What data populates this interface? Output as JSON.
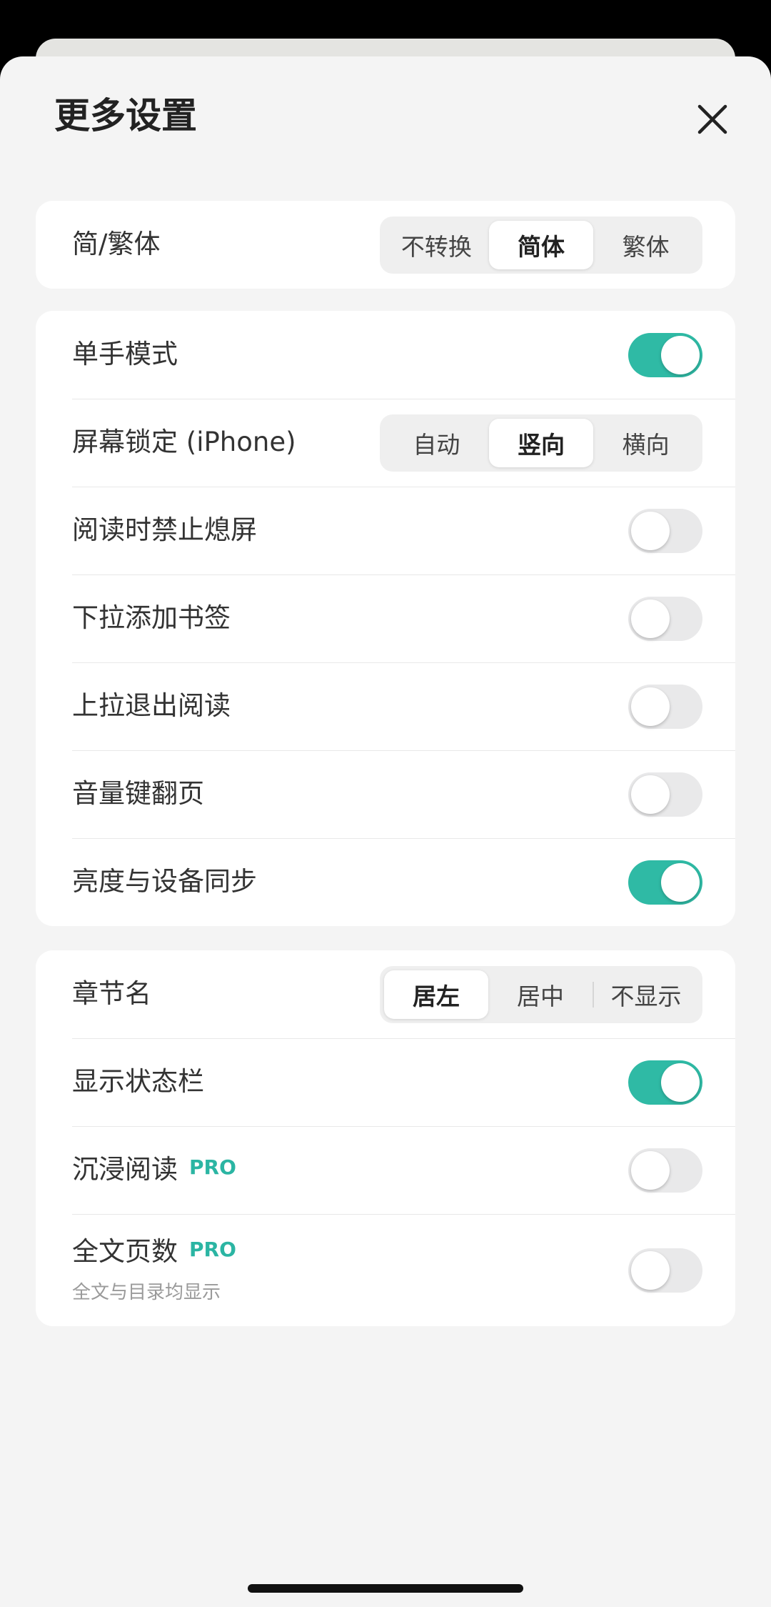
{
  "sheet": {
    "title": "更多设置",
    "close_icon": "close-icon"
  },
  "colors": {
    "accent": "#2fbaa5",
    "pro": "#2bb5a3",
    "toggle_off": "#e9e9ea"
  },
  "conversion": {
    "label": "简/繁体",
    "options": [
      "不转换",
      "简体",
      "繁体"
    ],
    "selected": "简体"
  },
  "reading": {
    "one_hand": {
      "label": "单手模式",
      "on": true
    },
    "screen_lock": {
      "label": "屏幕锁定 (iPhone)",
      "options": [
        "自动",
        "竖向",
        "横向"
      ],
      "selected": "竖向"
    },
    "keep_awake": {
      "label": "阅读时禁止熄屏",
      "on": false
    },
    "pull_bookmark": {
      "label": "下拉添加书签",
      "on": false
    },
    "pull_exit": {
      "label": "上拉退出阅读",
      "on": false
    },
    "volume_page": {
      "label": "音量键翻页",
      "on": false
    },
    "brightness_sync": {
      "label": "亮度与设备同步",
      "on": true
    }
  },
  "display": {
    "chapter_name": {
      "label": "章节名",
      "options": [
        "居左",
        "居中",
        "不显示"
      ],
      "selected": "居左"
    },
    "status_bar": {
      "label": "显示状态栏",
      "on": true
    },
    "immersive": {
      "label": "沉浸阅读",
      "badge": "PRO",
      "on": false
    },
    "page_count": {
      "label": "全文页数",
      "badge": "PRO",
      "sub": "全文与目录均显示",
      "on": false
    }
  }
}
